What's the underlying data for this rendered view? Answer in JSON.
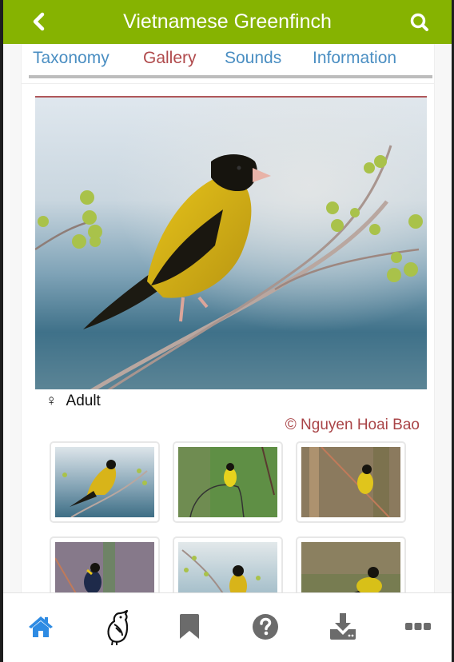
{
  "app_bar": {
    "title": "Vietnamese Greenfinch",
    "back_icon": "chevron-left-icon",
    "search_icon": "search-icon",
    "color": "#86b301"
  },
  "tabs": [
    {
      "label": "Taxonomy",
      "active": false
    },
    {
      "label": "Gallery",
      "active": true
    },
    {
      "label": "Sounds",
      "active": false
    },
    {
      "label": "Information",
      "active": false
    }
  ],
  "gallery": {
    "main_photo": {
      "description": "Vietnamese Greenfinch perched on a flowering branch with green berries against a blue-grey background",
      "caption_symbol": "♀",
      "caption": "Adult",
      "credit": "© Nguyen Hoai Bao"
    },
    "thumbnails": [
      {
        "description": "Greenfinch on branch with berries, blue background"
      },
      {
        "description": "Yellow greenfinch perched on curved twig, green background"
      },
      {
        "description": "Yellow greenfinch on diagonal stem, brown reeds background"
      },
      {
        "description": "Dark greenfinch on diagonal stem, purple-green background"
      },
      {
        "description": "Greenfinch beside flowering branch, pale background"
      },
      {
        "description": "Greenfinch on ground among grass"
      }
    ]
  },
  "bottom_nav": [
    {
      "icon": "home-icon",
      "label": "Home",
      "active": true,
      "color": "#2e8be3"
    },
    {
      "icon": "bird-icon",
      "label": "Birds",
      "active": false
    },
    {
      "icon": "bookmark-icon",
      "label": "Bookmarks",
      "active": false
    },
    {
      "icon": "help-icon",
      "label": "Help",
      "active": false
    },
    {
      "icon": "download-icon",
      "label": "Download",
      "active": false
    },
    {
      "icon": "more-icon",
      "label": "More",
      "active": false
    }
  ],
  "colors": {
    "active_tab": "#b04a4c",
    "inactive_tab": "#4a8ec2",
    "credit": "#a94447",
    "nav_icon": "#6b6b6b"
  }
}
